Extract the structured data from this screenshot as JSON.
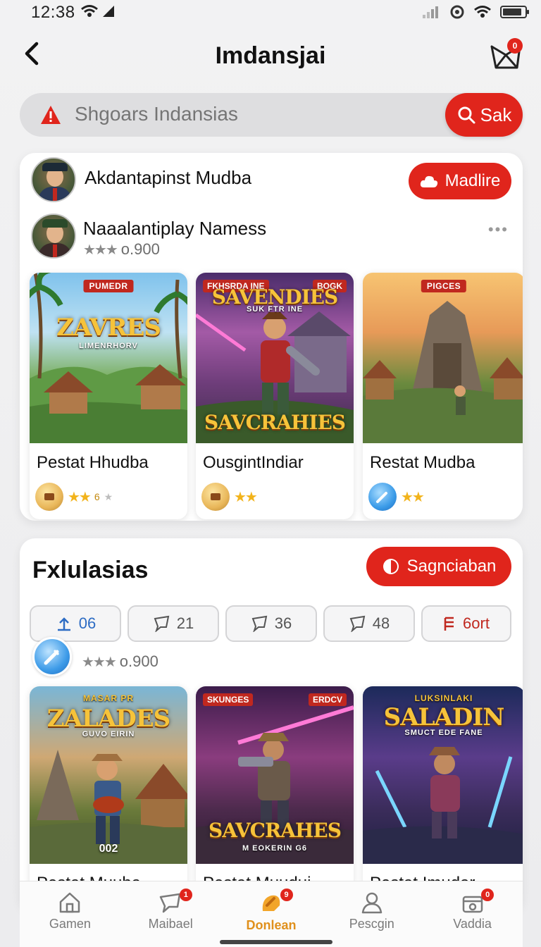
{
  "status": {
    "time": "12:38"
  },
  "header": {
    "title": "Imdansjai",
    "cart_badge": "0"
  },
  "search": {
    "placeholder": "Shgoars Indansias",
    "button_label": "Sak"
  },
  "featured": {
    "creator_name": "Akdantapinst Mudba",
    "follow_label": "Madlire",
    "subcreator_name": "Naaalantiplay Namess",
    "rating_text": "o.900",
    "more": "•••",
    "games": [
      {
        "title": "Pestat Hhudba",
        "art_tag": "PUMEDR",
        "logo": "ZAVRES",
        "logo_sub": "LIMENRHORV",
        "rating_num": "6"
      },
      {
        "title": "OusgintIndiar",
        "art_tag_left": "FKHSRDA INE",
        "art_tag_right": "BOGK",
        "logo": "SAVENDIES",
        "logo_sub": "SUK FTR INE",
        "logo2": "SAVCRAHIES"
      },
      {
        "title": "Restat Mudba",
        "art_tag": "PIGCES"
      }
    ]
  },
  "exclusive": {
    "title": "Fxlulasias",
    "button_label": "Sagnciaban",
    "chips": [
      "06",
      "21",
      "36",
      "48",
      "6ort"
    ],
    "rating_text": "o.900",
    "games": [
      {
        "title": "Pestat Muuba",
        "logo": "ZALADES",
        "logo_top": "MASAR PR",
        "logo_sub": "GUVO EIRIN",
        "foot": "002"
      },
      {
        "title": "Pestat Muudui",
        "art_tag_left": "SKUNGES",
        "art_tag_right": "ERDCV",
        "logo": "SAVCRAHES",
        "logo_sub": "M EOKERIN G6"
      },
      {
        "title": "Pestat Imudar",
        "logo_top": "LUKSINLAKI",
        "logo": "SALADIN",
        "logo_sub": "SMUCT EDE FANE"
      }
    ]
  },
  "bottom_nav": [
    {
      "label": "Gamen",
      "icon": "home-icon"
    },
    {
      "label": "Maibael",
      "icon": "chat-icon",
      "badge": "1"
    },
    {
      "label": "Donlean",
      "icon": "play-icon",
      "badge": "9"
    },
    {
      "label": "Pescgin",
      "icon": "user-icon"
    },
    {
      "label": "Vaddia",
      "icon": "store-icon",
      "badge": "0"
    }
  ],
  "colors": {
    "accent": "#e0251c",
    "active_nav": "#e0901c",
    "gold": "#f2b31b"
  }
}
